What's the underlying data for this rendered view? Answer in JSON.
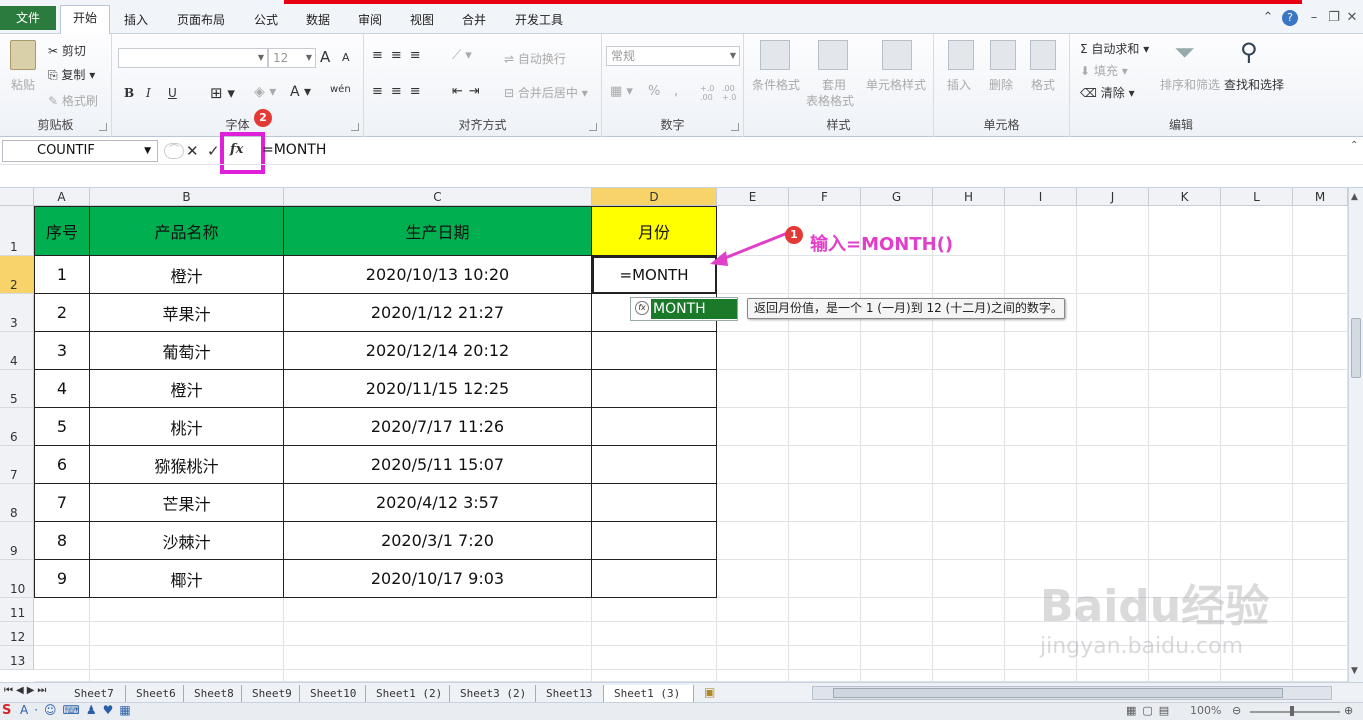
{
  "tabs": [
    "文件",
    "开始",
    "插入",
    "页面布局",
    "公式",
    "数据",
    "审阅",
    "视图",
    "合并",
    "开发工具"
  ],
  "ribbon": {
    "clipboard": {
      "paste": "粘贴",
      "cut": "剪切",
      "copy": "复制",
      "format_painter": "格式刷",
      "label": "剪贴板"
    },
    "font": {
      "size": "12",
      "label": "字体",
      "bold": "B",
      "italic": "I",
      "underline": "U",
      "font_color": "A",
      "grow": "A",
      "shrink": "A",
      "phonetic": "wén"
    },
    "align": {
      "wrap": "自动换行",
      "merge": "合并后居中",
      "label": "对齐方式"
    },
    "number": {
      "format": "常规",
      "label": "数字",
      "percent": "%",
      "comma": ",",
      "inc_dec": "+.0 .00",
      "dec_dec": ".00 +.0"
    },
    "styles": {
      "cond": "条件格式",
      "table1": "套用",
      "table2": "表格格式",
      "cell": "单元格样式",
      "label": "样式"
    },
    "cells": {
      "insert": "插入",
      "delete": "删除",
      "format": "格式",
      "label": "单元格"
    },
    "edit": {
      "autosum": "自动求和",
      "fill": "填充",
      "clear": "清除",
      "sort": "排序和筛选",
      "find": "查找和选择",
      "label": "编辑"
    }
  },
  "formula_bar": {
    "name_box": "COUNTIF",
    "formula": "=MONTH",
    "fx": "fx"
  },
  "columns": [
    "A",
    "B",
    "C",
    "D",
    "E",
    "F",
    "G",
    "H",
    "I",
    "J",
    "K",
    "L",
    "M"
  ],
  "rows": [
    "1",
    "2",
    "3",
    "4",
    "5",
    "6",
    "7",
    "8",
    "9",
    "10",
    "11",
    "12",
    "13"
  ],
  "table": {
    "headers": [
      "序号",
      "产品名称",
      "生产日期",
      "月份"
    ],
    "data": [
      [
        "1",
        "橙汁",
        "2020/10/13 10:20",
        "=MONTH"
      ],
      [
        "2",
        "苹果汁",
        "2020/1/12 21:27",
        ""
      ],
      [
        "3",
        "葡萄汁",
        "2020/12/14 20:12",
        ""
      ],
      [
        "4",
        "橙汁",
        "2020/11/15 12:25",
        ""
      ],
      [
        "5",
        "桃汁",
        "2020/7/17 11:26",
        ""
      ],
      [
        "6",
        "猕猴桃汁",
        "2020/5/11 15:07",
        ""
      ],
      [
        "7",
        "芒果汁",
        "2020/4/12 3:57",
        ""
      ],
      [
        "8",
        "沙棘汁",
        "2020/3/1 7:20",
        ""
      ],
      [
        "9",
        "椰汁",
        "2020/10/17 9:03",
        ""
      ]
    ]
  },
  "autocomplete": {
    "item": "MONTH",
    "tooltip": "返回月份值，是一个 1 (一月)到 12 (十二月)之间的数字。"
  },
  "annotation": {
    "text": "输入=MONTH()",
    "badge1": "1",
    "badge2": "2"
  },
  "sheets": [
    "Sheet7",
    "Sheet6",
    "Sheet8",
    "Sheet9",
    "Sheet10",
    "Sheet1 (2)",
    "Sheet3 (2)",
    "Sheet13",
    "Sheet1 (3)"
  ],
  "status": {
    "zoom": "100%"
  },
  "watermark": {
    "line1": "Baidu经验",
    "line2": "jingyan.baidu.com"
  },
  "colors": {
    "header_green": "#00b050",
    "header_yellow": "#ffff00",
    "highlight": "#e020d8",
    "file_tab": "#2a7b3d"
  }
}
